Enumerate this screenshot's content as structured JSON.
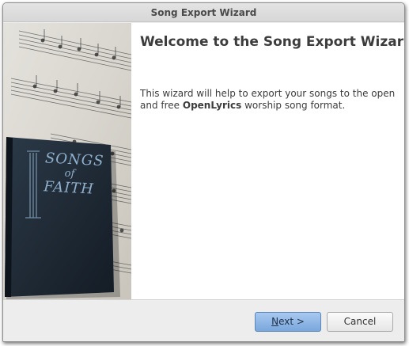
{
  "window": {
    "title": "Song Export Wizard"
  },
  "sidebar": {
    "image_alt": "Songs of Faith hymn book on sheet music",
    "book_title_line1": "SONGS",
    "book_title_line2": "of",
    "book_title_line3": "FAITH"
  },
  "page": {
    "heading": "Welcome to the Song Export Wizard",
    "description_part1": "This wizard will help to export your songs to the open and free ",
    "description_bold": "OpenLyrics",
    "description_part2": " worship song format."
  },
  "buttons": {
    "next_mnemonic": "N",
    "next_rest": "ext >",
    "cancel_label": "Cancel"
  },
  "colors": {
    "accent_button": "#7aa7dd",
    "book_cover": "#1f2a36",
    "text": "#3c3c3c"
  }
}
